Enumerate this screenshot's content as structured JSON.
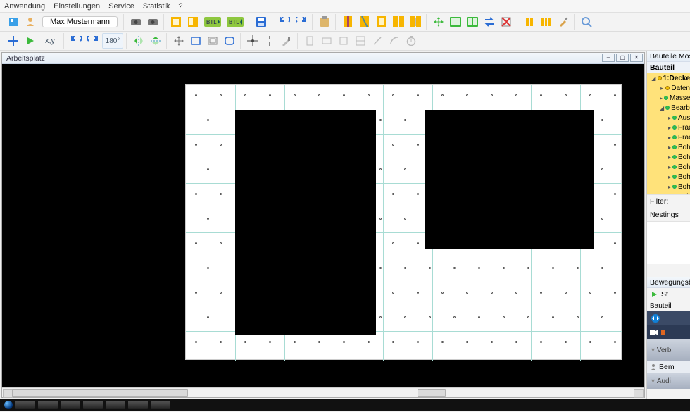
{
  "menu": {
    "anwendung": "Anwendung",
    "einstellungen": "Einstellungen",
    "service": "Service",
    "statistik": "Statistik",
    "help": "?"
  },
  "user": {
    "name": "Max Mustermann"
  },
  "toolbar1": {
    "btl1": "BTL",
    "btl2": "BTL"
  },
  "toolbar2": {
    "xy_label": "x,y",
    "rot_label": "180°"
  },
  "workspace": {
    "title": "Arbeitsplatz"
  },
  "side": {
    "title": "Bauteile Moser -Th",
    "sub": "Bauteil",
    "tree": {
      "root": "1:Decke",
      "items": [
        "Daten",
        "Masse",
        "Bearbeitu",
        "Ausse",
        "Fraes",
        "Fraes",
        "Bohrf",
        "Bohrf",
        "Bohrf",
        "Bohrf",
        "Bohrf",
        "Bohrf"
      ]
    },
    "filter_label": "Filter:",
    "nestings_label": "Nestings",
    "paths_label": "Bewegungsbahnen",
    "start": "St",
    "bauteil": "Bauteil",
    "verb": "Verb",
    "bem": "Bem",
    "audi": "Audi"
  }
}
